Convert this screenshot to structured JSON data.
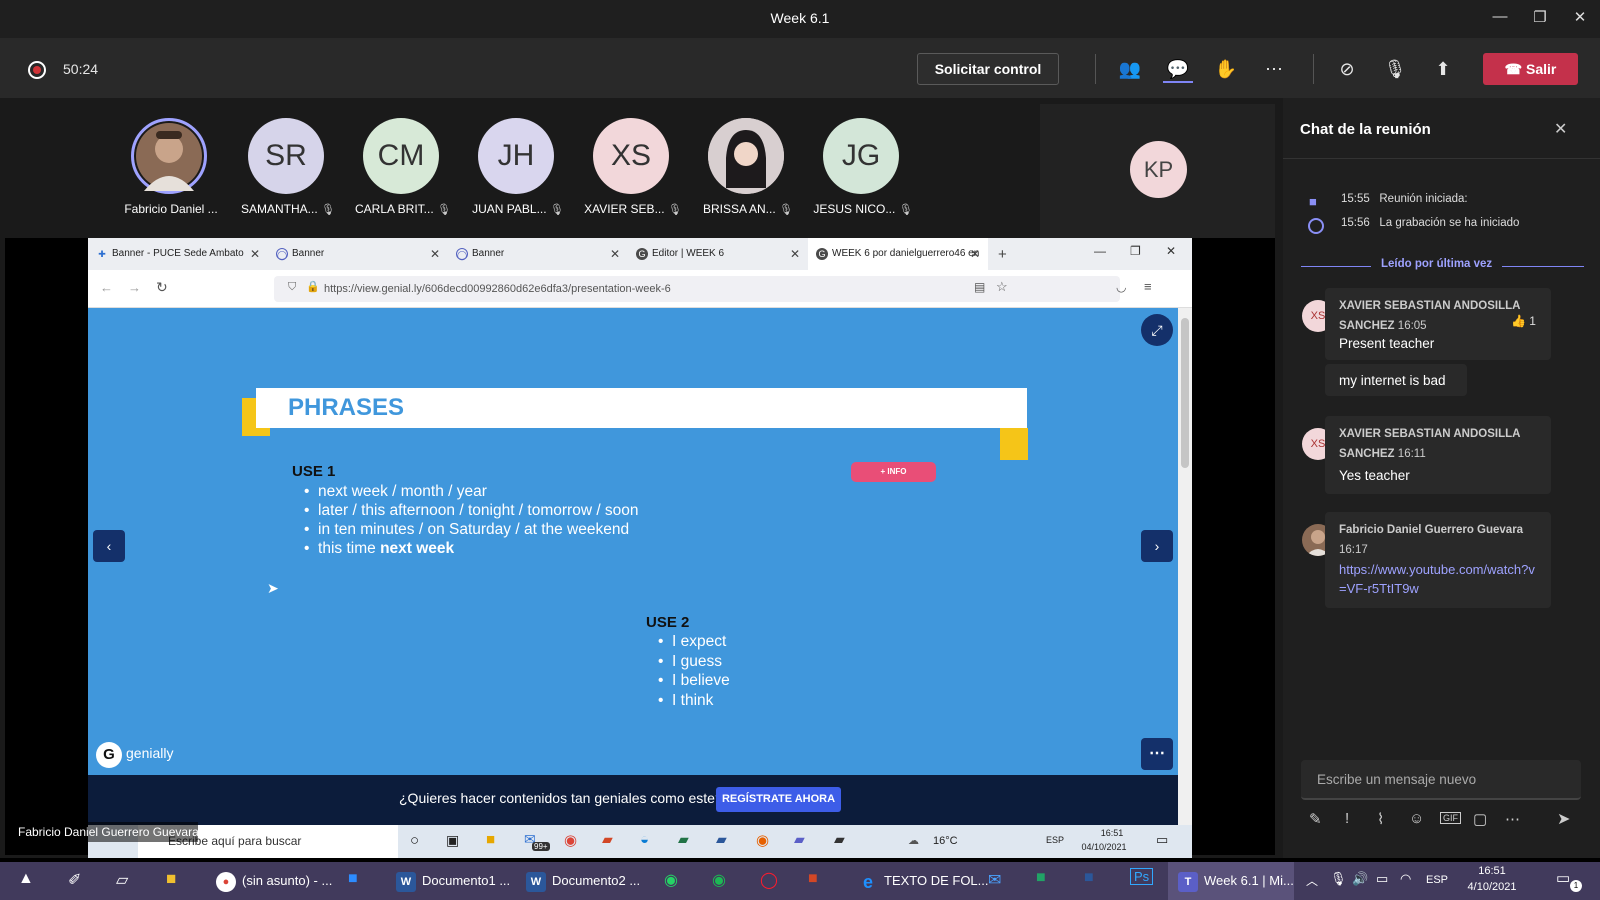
{
  "window": {
    "title": "Week 6.1"
  },
  "callbar": {
    "timer": "50:24",
    "request_control": "Solicitar control",
    "leave": "Salir"
  },
  "participants": [
    {
      "name": "Fabricio Daniel ...",
      "initials": "",
      "color": "#8a6a55",
      "photo": true
    },
    {
      "name": "SAMANTHA...",
      "initials": "SR",
      "color": "#d6d4ea"
    },
    {
      "name": "CARLA BRIT...",
      "initials": "CM",
      "color": "#d7e9d7"
    },
    {
      "name": "JUAN PABL...",
      "initials": "JH",
      "color": "#d9d6ee"
    },
    {
      "name": "XAVIER SEB...",
      "initials": "XS",
      "color": "#f2d7da"
    },
    {
      "name": "BRISSA AN...",
      "initials": "",
      "color": "#bfb3b5",
      "photo": true
    },
    {
      "name": "JESUS NICO...",
      "initials": "JG",
      "color": "#d3e6d8"
    }
  ],
  "spotlight": {
    "initials": "KP"
  },
  "presenter_label": "Fabricio Daniel Guerrero Guevara",
  "browser": {
    "tabs": [
      {
        "label": "Banner - PUCE Sede Ambato"
      },
      {
        "label": "Banner"
      },
      {
        "label": "Banner"
      },
      {
        "label": "Editor | WEEK 6"
      },
      {
        "label": "WEEK 6 por danielguerrero46 en"
      }
    ],
    "url": "https://view.genial.ly/606decd00992860d62e6dfa3/presentation-week-6"
  },
  "slide": {
    "title": "PHRASES",
    "info_button": "+ INFO",
    "use1_heading": "USE 1",
    "use1_items": [
      "next week / month / year",
      "later / this afternoon / tonight / tomorrow / soon",
      "in ten minutes / on Saturday / at the weekend",
      "this time "
    ],
    "use1_bold": "next week",
    "use2_heading": "USE 2",
    "use2_items": [
      "I expect",
      "I guess",
      "I believe",
      "I think"
    ],
    "brand": "genially",
    "banner_text": "¿Quieres hacer contenidos tan geniales como este?",
    "banner_button": "REGÍSTRATE AHORA"
  },
  "inner_taskbar": {
    "search": "Escribe aquí para buscar",
    "temp": "16°C",
    "lang": "ESP",
    "time": "16:51",
    "date": "04/10/2021",
    "badge": "99+"
  },
  "chat": {
    "title": "Chat de la reunión",
    "events": [
      {
        "time": "15:55",
        "text": "Reunión iniciada:"
      },
      {
        "time": "15:56",
        "text": "La grabación se ha iniciado"
      }
    ],
    "last_read": "Leído por última vez",
    "messages": [
      {
        "initials": "XS",
        "author": "XAVIER SEBASTIAN ANDOSILLA SANCHEZ",
        "time": "16:05",
        "text": "Present teacher",
        "reaction": "1"
      },
      {
        "text": "my internet is bad"
      },
      {
        "initials": "XS",
        "author": "XAVIER SEBASTIAN ANDOSILLA SANCHEZ",
        "time": "16:11",
        "text": "Yes teacher"
      },
      {
        "author": "Fabricio Daniel Guerrero Guevara",
        "time": "16:17",
        "link": "https://www.youtube.com/watch?v=VF-r5TtIT9w"
      }
    ],
    "compose_placeholder": "Escribe un mensaje nuevo"
  },
  "taskbar": {
    "apps": [
      {
        "label": "(sin asunto) - ..."
      },
      {
        "label": "Documento1 ..."
      },
      {
        "label": "Documento2 ..."
      },
      {
        "label": "TEXTO DE FOL..."
      },
      {
        "label": "Week 6.1 | Mi..."
      }
    ],
    "lang": "ESP",
    "time": "16:51",
    "date": "4/10/2021",
    "notif": "1"
  }
}
